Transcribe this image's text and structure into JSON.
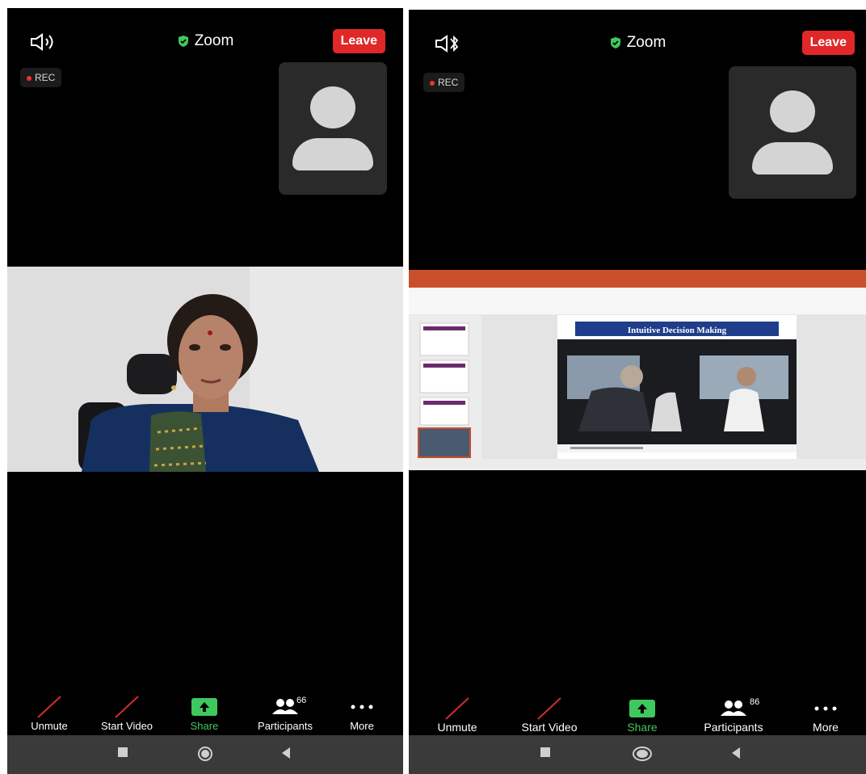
{
  "screens": [
    {
      "title": "Zoom",
      "leave_label": "Leave",
      "rec_label": "REC",
      "toolbar": {
        "unmute": "Unmute",
        "start_video": "Start Video",
        "share": "Share",
        "participants": "Participants",
        "participants_count": "66",
        "more": "More"
      }
    },
    {
      "title": "Zoom",
      "leave_label": "Leave",
      "rec_label": "REC",
      "slide_title": "Intuitive Decision Making",
      "toolbar": {
        "unmute": "Unmute",
        "start_video": "Start Video",
        "share": "Share",
        "participants": "Participants",
        "participants_count": "86",
        "more": "More"
      }
    }
  ],
  "icons": [
    "speaker-icon",
    "bluetooth-icon",
    "shield-check-icon",
    "avatar-icon",
    "muted-mic-icon",
    "video-off-icon",
    "share-arrow-icon",
    "participants-icon",
    "more-dots-icon",
    "square-nav-icon",
    "home-nav-icon",
    "back-nav-icon"
  ],
  "colors": {
    "leave": "#e02828",
    "share": "#3fc85e",
    "background": "#000000",
    "rec_dot": "#e33333"
  }
}
